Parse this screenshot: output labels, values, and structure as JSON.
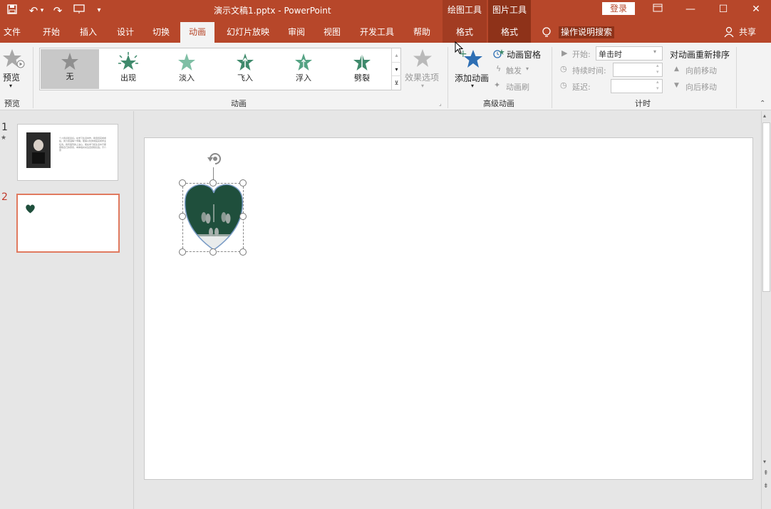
{
  "app": {
    "doc_title": "演示文稿1.pptx  -  PowerPoint",
    "context_tools": [
      "绘图工具",
      "图片工具"
    ],
    "login": "登录",
    "share": "共享",
    "search": "操作说明搜索"
  },
  "tabs": [
    "文件",
    "开始",
    "插入",
    "设计",
    "切换",
    "动画",
    "幻灯片放映",
    "审阅",
    "视图",
    "开发工具",
    "帮助",
    "格式",
    "格式"
  ],
  "ribbon": {
    "preview": "预览",
    "preview_group": "预览",
    "animations": [
      "无",
      "出现",
      "淡入",
      "飞入",
      "浮入",
      "劈裂"
    ],
    "effect_options": "效果选项",
    "animation_group": "动画",
    "add_animation": "添加动画",
    "animation_pane": "动画窗格",
    "trigger": "触发",
    "animation_painter": "动画刷",
    "advanced_group": "高级动画",
    "start_label": "开始:",
    "start_value": "单击时",
    "duration_label": "持续时间:",
    "delay_label": "延迟:",
    "reorder_title": "对动画重新排序",
    "move_earlier": "向前移动",
    "move_later": "向后移动",
    "timing_group": "计时"
  },
  "slides": [
    {
      "number": "1",
      "text": "个人特点和爱好。在学习生活中作，我坚持完成成绩，努力奋进每个学期。能够以优秀成绩完成学业任务。我有强烈的上进心，能在学习和生活中不断磨练自己的意志，本体验并关注自然和社会。不介意"
    },
    {
      "number": "2"
    }
  ],
  "colors": {
    "accent": "#b7472a",
    "heart": "#1f4f3c",
    "selected_tab_bg": "#f3f3f3"
  }
}
